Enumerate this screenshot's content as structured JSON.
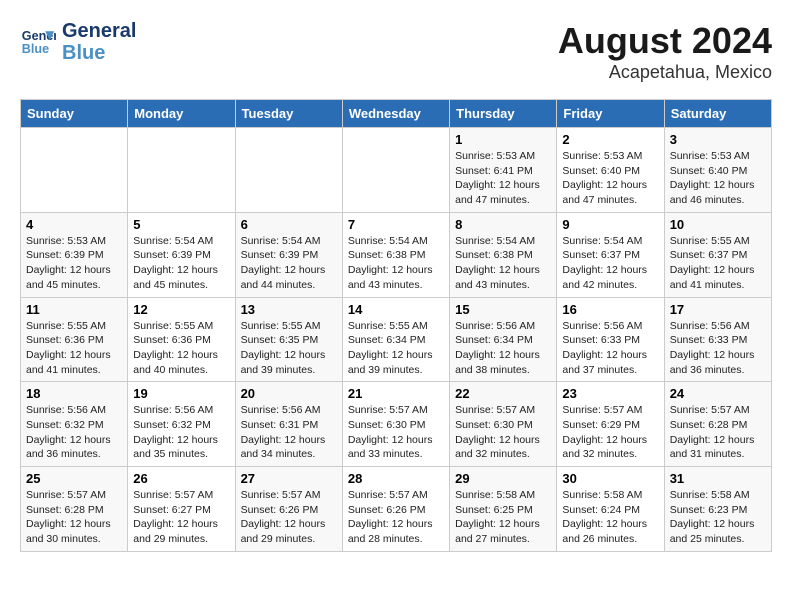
{
  "header": {
    "logo_line1": "General",
    "logo_line2": "Blue",
    "main_title": "August 2024",
    "sub_title": "Acapetahua, Mexico"
  },
  "days_of_week": [
    "Sunday",
    "Monday",
    "Tuesday",
    "Wednesday",
    "Thursday",
    "Friday",
    "Saturday"
  ],
  "weeks": [
    [
      {
        "num": "",
        "info": ""
      },
      {
        "num": "",
        "info": ""
      },
      {
        "num": "",
        "info": ""
      },
      {
        "num": "",
        "info": ""
      },
      {
        "num": "1",
        "info": "Sunrise: 5:53 AM\nSunset: 6:41 PM\nDaylight: 12 hours\nand 47 minutes."
      },
      {
        "num": "2",
        "info": "Sunrise: 5:53 AM\nSunset: 6:40 PM\nDaylight: 12 hours\nand 47 minutes."
      },
      {
        "num": "3",
        "info": "Sunrise: 5:53 AM\nSunset: 6:40 PM\nDaylight: 12 hours\nand 46 minutes."
      }
    ],
    [
      {
        "num": "4",
        "info": "Sunrise: 5:53 AM\nSunset: 6:39 PM\nDaylight: 12 hours\nand 45 minutes."
      },
      {
        "num": "5",
        "info": "Sunrise: 5:54 AM\nSunset: 6:39 PM\nDaylight: 12 hours\nand 45 minutes."
      },
      {
        "num": "6",
        "info": "Sunrise: 5:54 AM\nSunset: 6:39 PM\nDaylight: 12 hours\nand 44 minutes."
      },
      {
        "num": "7",
        "info": "Sunrise: 5:54 AM\nSunset: 6:38 PM\nDaylight: 12 hours\nand 43 minutes."
      },
      {
        "num": "8",
        "info": "Sunrise: 5:54 AM\nSunset: 6:38 PM\nDaylight: 12 hours\nand 43 minutes."
      },
      {
        "num": "9",
        "info": "Sunrise: 5:54 AM\nSunset: 6:37 PM\nDaylight: 12 hours\nand 42 minutes."
      },
      {
        "num": "10",
        "info": "Sunrise: 5:55 AM\nSunset: 6:37 PM\nDaylight: 12 hours\nand 41 minutes."
      }
    ],
    [
      {
        "num": "11",
        "info": "Sunrise: 5:55 AM\nSunset: 6:36 PM\nDaylight: 12 hours\nand 41 minutes."
      },
      {
        "num": "12",
        "info": "Sunrise: 5:55 AM\nSunset: 6:36 PM\nDaylight: 12 hours\nand 40 minutes."
      },
      {
        "num": "13",
        "info": "Sunrise: 5:55 AM\nSunset: 6:35 PM\nDaylight: 12 hours\nand 39 minutes."
      },
      {
        "num": "14",
        "info": "Sunrise: 5:55 AM\nSunset: 6:34 PM\nDaylight: 12 hours\nand 39 minutes."
      },
      {
        "num": "15",
        "info": "Sunrise: 5:56 AM\nSunset: 6:34 PM\nDaylight: 12 hours\nand 38 minutes."
      },
      {
        "num": "16",
        "info": "Sunrise: 5:56 AM\nSunset: 6:33 PM\nDaylight: 12 hours\nand 37 minutes."
      },
      {
        "num": "17",
        "info": "Sunrise: 5:56 AM\nSunset: 6:33 PM\nDaylight: 12 hours\nand 36 minutes."
      }
    ],
    [
      {
        "num": "18",
        "info": "Sunrise: 5:56 AM\nSunset: 6:32 PM\nDaylight: 12 hours\nand 36 minutes."
      },
      {
        "num": "19",
        "info": "Sunrise: 5:56 AM\nSunset: 6:32 PM\nDaylight: 12 hours\nand 35 minutes."
      },
      {
        "num": "20",
        "info": "Sunrise: 5:56 AM\nSunset: 6:31 PM\nDaylight: 12 hours\nand 34 minutes."
      },
      {
        "num": "21",
        "info": "Sunrise: 5:57 AM\nSunset: 6:30 PM\nDaylight: 12 hours\nand 33 minutes."
      },
      {
        "num": "22",
        "info": "Sunrise: 5:57 AM\nSunset: 6:30 PM\nDaylight: 12 hours\nand 32 minutes."
      },
      {
        "num": "23",
        "info": "Sunrise: 5:57 AM\nSunset: 6:29 PM\nDaylight: 12 hours\nand 32 minutes."
      },
      {
        "num": "24",
        "info": "Sunrise: 5:57 AM\nSunset: 6:28 PM\nDaylight: 12 hours\nand 31 minutes."
      }
    ],
    [
      {
        "num": "25",
        "info": "Sunrise: 5:57 AM\nSunset: 6:28 PM\nDaylight: 12 hours\nand 30 minutes."
      },
      {
        "num": "26",
        "info": "Sunrise: 5:57 AM\nSunset: 6:27 PM\nDaylight: 12 hours\nand 29 minutes."
      },
      {
        "num": "27",
        "info": "Sunrise: 5:57 AM\nSunset: 6:26 PM\nDaylight: 12 hours\nand 29 minutes."
      },
      {
        "num": "28",
        "info": "Sunrise: 5:57 AM\nSunset: 6:26 PM\nDaylight: 12 hours\nand 28 minutes."
      },
      {
        "num": "29",
        "info": "Sunrise: 5:58 AM\nSunset: 6:25 PM\nDaylight: 12 hours\nand 27 minutes."
      },
      {
        "num": "30",
        "info": "Sunrise: 5:58 AM\nSunset: 6:24 PM\nDaylight: 12 hours\nand 26 minutes."
      },
      {
        "num": "31",
        "info": "Sunrise: 5:58 AM\nSunset: 6:23 PM\nDaylight: 12 hours\nand 25 minutes."
      }
    ]
  ]
}
